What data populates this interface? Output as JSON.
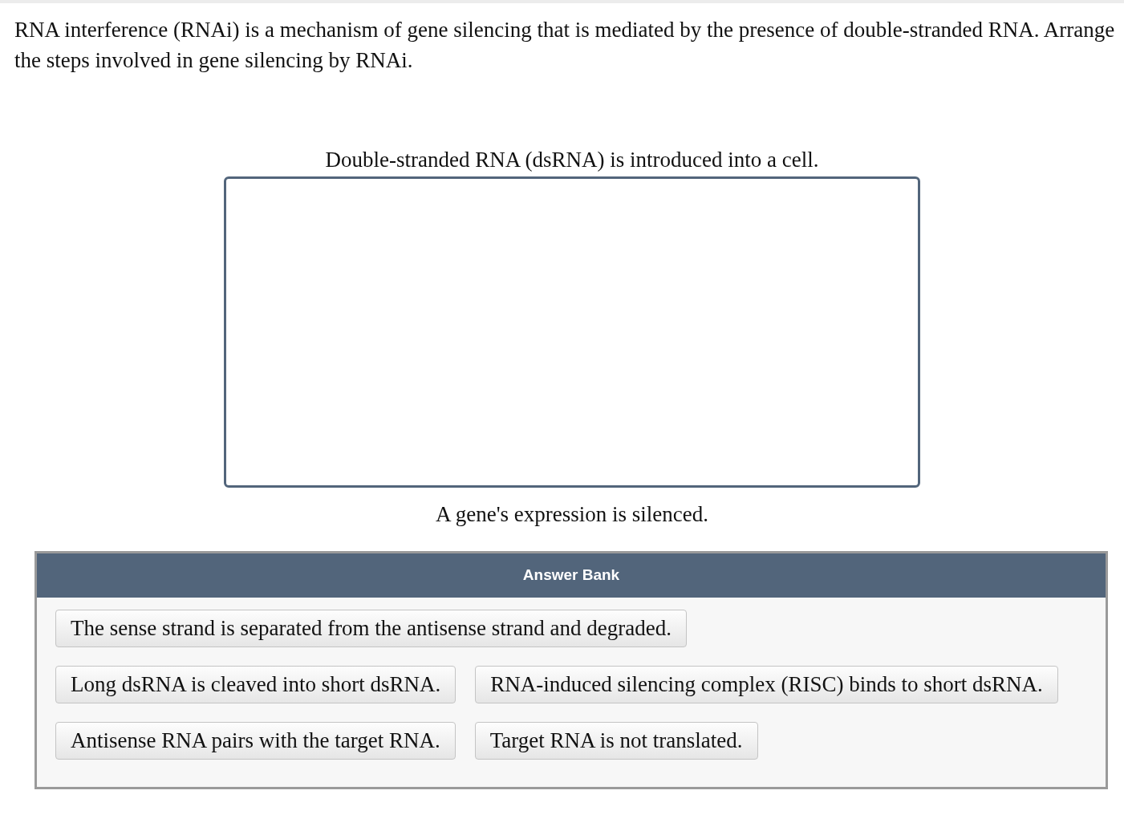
{
  "question": "RNA interference (RNAi) is a mechanism of gene silencing that is mediated by the presence of double-stranded RNA. Arrange the steps involved in gene silencing by RNAi.",
  "ordering": {
    "first_step": "Double-stranded RNA (dsRNA) is introduced into a cell.",
    "last_step": "A gene's expression is silenced."
  },
  "answer_bank": {
    "title": "Answer Bank",
    "options": [
      "The sense strand is separated from the antisense strand and degraded.",
      "Long dsRNA is cleaved into short dsRNA.",
      "RNA-induced silencing complex (RISC) binds to short dsRNA.",
      "Antisense RNA pairs with the target RNA.",
      "Target RNA is not translated."
    ]
  }
}
